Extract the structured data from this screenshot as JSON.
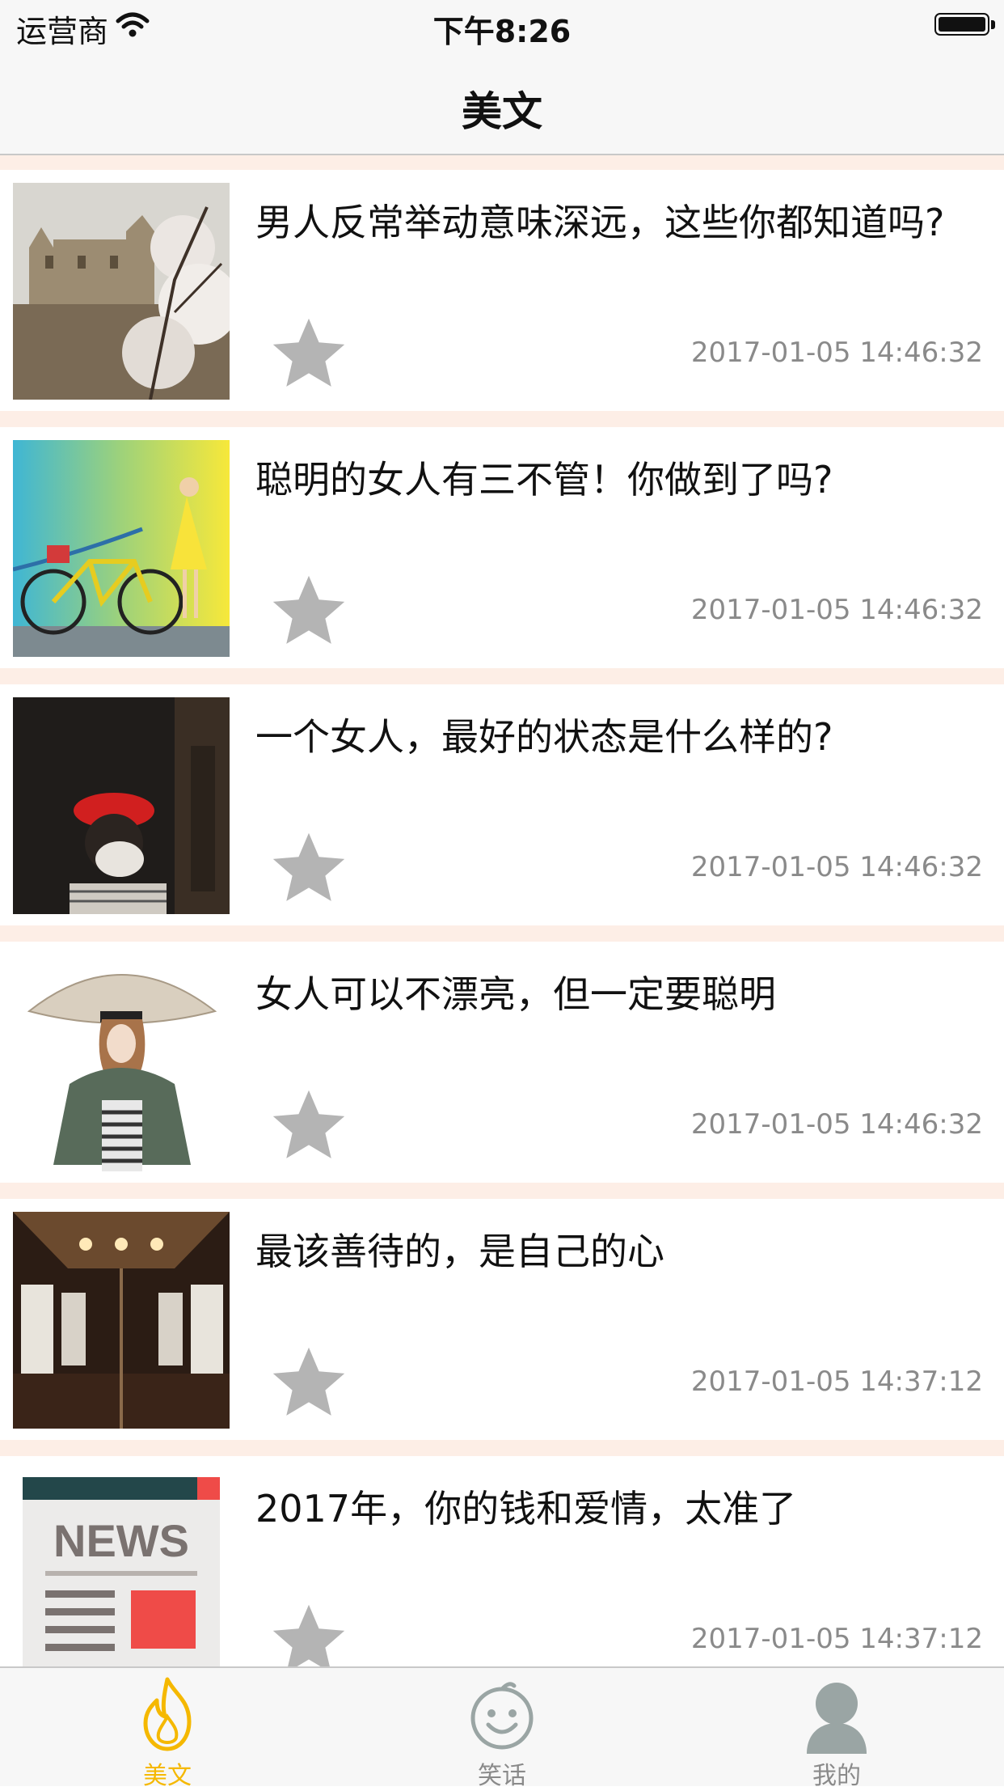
{
  "status_bar": {
    "carrier": "运营商",
    "time": "下午8:26"
  },
  "nav": {
    "title": "美文"
  },
  "articles": [
    {
      "title": "男人反常举动意味深远，这些你都知道吗?",
      "time": "2017-01-05 14:46:32",
      "thumb": "castle-blossom-photo"
    },
    {
      "title": "聪明的女人有三不管！你做到了吗?",
      "time": "2017-01-05 14:46:32",
      "thumb": "woman-bicycle-wall-photo"
    },
    {
      "title": "一个女人，最好的状态是什么样的?",
      "time": "2017-01-05 14:46:32",
      "thumb": "woman-red-beret-photo"
    },
    {
      "title": "女人可以不漂亮，但一定要聪明",
      "time": "2017-01-05 14:46:32",
      "thumb": "woman-straw-hat-illustration"
    },
    {
      "title": "最该善待的，是自己的心",
      "time": "2017-01-05 14:37:12",
      "thumb": "tram-interior-photo"
    },
    {
      "title": "2017年，你的钱和爱情，太准了",
      "time": "2017-01-05 14:37:12",
      "thumb": "news-icon",
      "thumb_text": "NEWS"
    }
  ],
  "tabs": [
    {
      "label": "美文",
      "icon": "flame-icon",
      "active": true
    },
    {
      "label": "笑话",
      "icon": "smiley-face-icon",
      "active": false
    },
    {
      "label": "我的",
      "icon": "user-silhouette-icon",
      "active": false
    }
  ],
  "colors": {
    "accent": "#f5b800",
    "star": "#b4b4b4",
    "separator": "#fdeee6",
    "timestamp": "#8a8a8a"
  }
}
